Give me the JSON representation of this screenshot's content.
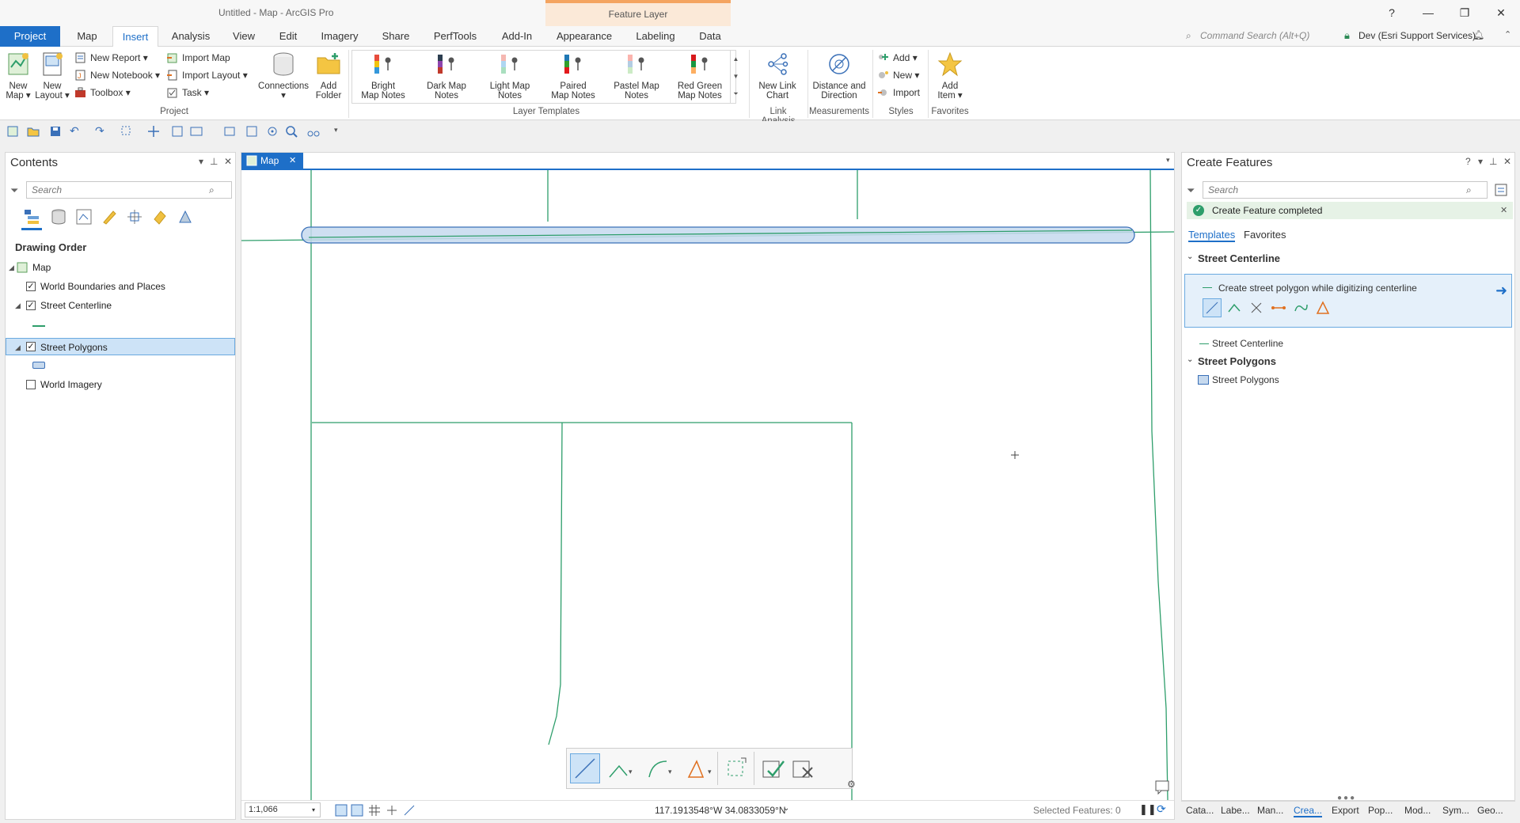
{
  "app": {
    "title": "Untitled - Map - ArcGIS Pro",
    "context_tab_group": "Feature Layer"
  },
  "window_controls": {
    "help": "?",
    "minimize": "—",
    "restore": "❐",
    "close": "✕"
  },
  "tabs": [
    "Project",
    "Map",
    "Insert",
    "Analysis",
    "View",
    "Edit",
    "Imagery",
    "Share",
    "PerfTools",
    "Add-In",
    "Appearance",
    "Labeling",
    "Data"
  ],
  "command_search": {
    "placeholder": "Command Search (Alt+Q)"
  },
  "account": {
    "label": "Dev (Esri Support Services)"
  },
  "ribbon": {
    "new_map": [
      "New",
      "Map"
    ],
    "new_layout": [
      "New",
      "Layout"
    ],
    "new_report": "New Report",
    "new_notebook": "New Notebook",
    "toolbox": "Toolbox",
    "import_map": "Import Map",
    "import_layout": "Import Layout",
    "task": "Task",
    "connections": "Connections",
    "add_folder": [
      "Add",
      "Folder"
    ],
    "group_project": "Project",
    "templates": [
      {
        "l1": "Bright",
        "l2": "Map Notes"
      },
      {
        "l1": "Dark Map",
        "l2": "Notes"
      },
      {
        "l1": "Light Map",
        "l2": "Notes"
      },
      {
        "l1": "Paired",
        "l2": "Map Notes"
      },
      {
        "l1": "Pastel Map",
        "l2": "Notes"
      },
      {
        "l1": "Red Green",
        "l2": "Map Notes"
      }
    ],
    "group_layer_templates": "Layer Templates",
    "new_link_chart": [
      "New Link",
      "Chart"
    ],
    "group_link_analysis": "Link Analysis",
    "distance_direction": [
      "Distance and",
      "Direction"
    ],
    "group_measurements": "Measurements",
    "styles_add": "Add",
    "styles_new": "New",
    "styles_import": "Import",
    "group_styles": "Styles",
    "add_item": [
      "Add",
      "Item"
    ],
    "group_favorites": "Favorites"
  },
  "contents": {
    "title": "Contents",
    "search_placeholder": "Search",
    "drawing_order": "Drawing Order",
    "map": "Map",
    "layers": [
      {
        "name": "World Boundaries and Places",
        "checked": "✓"
      },
      {
        "name": "Street Centerline",
        "checked": "✓"
      },
      {
        "name": "Street Polygons",
        "checked": "✓"
      },
      {
        "name": "World Imagery",
        "checked": ""
      }
    ]
  },
  "map": {
    "tab_label": "Map",
    "scale": "1:1,066",
    "coordinates": "117.1913548°W 34.0833059°N",
    "selected_features": "Selected Features: 0"
  },
  "create_features": {
    "title": "Create Features",
    "search_placeholder": "Search",
    "banner": "Create Feature completed",
    "tab_templates": "Templates",
    "tab_favorites": "Favorites",
    "group1": "Street Centerline",
    "selected_template": "Create street polygon while digitizing centerline",
    "item_centerline": "Street Centerline",
    "group2": "Street Polygons",
    "item_polygons": "Street Polygons"
  },
  "bottom_tabs": [
    "Cata...",
    "Labe...",
    "Man...",
    "Crea...",
    "Export",
    "Pop...",
    "Mod...",
    "Sym...",
    "Geo..."
  ],
  "colors": {
    "accent": "#1e6fc8",
    "street_line": "#2e9e6b",
    "polygon_fill": "#c6d9ee",
    "polygon_stroke": "#3a70b8"
  }
}
